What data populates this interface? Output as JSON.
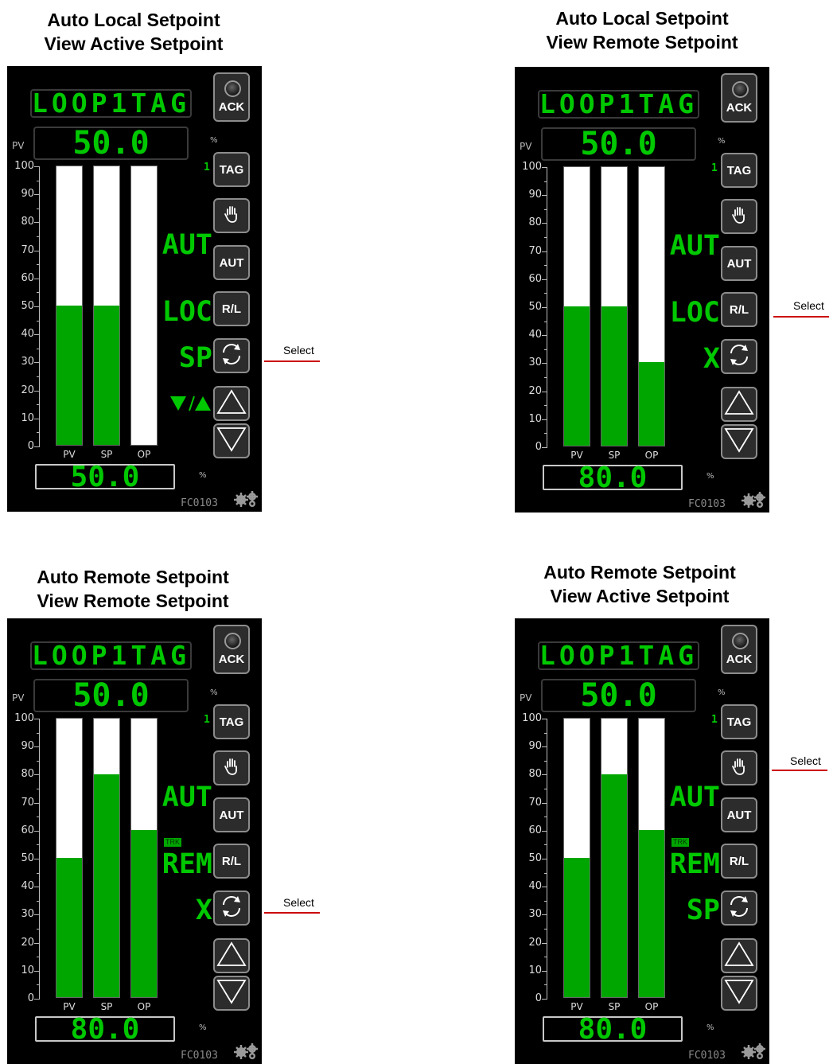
{
  "panels": [
    {
      "title1": "Auto Local Setpoint",
      "title2": "View Active Setpoint",
      "tag": "LOOP1TAG",
      "pv_label": "PV",
      "pv": "50.0",
      "unit": "%",
      "op": "50.0",
      "tag_code": "FC0103",
      "bars": {
        "PV": 50,
        "SP": 50,
        "OP": 0
      },
      "bar_labels": [
        "PV",
        "SP",
        "OP"
      ],
      "loop_num": "1",
      "mode": "AUT",
      "sp_mode": "LOC",
      "sp_view": "SP",
      "show_arrows": true,
      "trk": false,
      "buttons": {
        "ack": "ACK",
        "tag": "TAG",
        "aut": "AUT",
        "rl": "R/L"
      },
      "select_label": "Select",
      "select_target": "cycle"
    },
    {
      "title1": "Auto Local Setpoint",
      "title2": "View Remote Setpoint",
      "tag": "LOOP1TAG",
      "pv_label": "PV",
      "pv": "50.0",
      "unit": "%",
      "op": "80.0",
      "tag_code": "FC0103",
      "bars": {
        "PV": 50,
        "SP": 50,
        "OP": 30
      },
      "bar_labels": [
        "PV",
        "SP",
        "OP"
      ],
      "loop_num": "1",
      "mode": "AUT",
      "sp_mode": "LOC",
      "sp_view": "X",
      "show_arrows": false,
      "trk": false,
      "buttons": {
        "ack": "ACK",
        "tag": "TAG",
        "aut": "AUT",
        "rl": "R/L"
      },
      "select_label": "Select",
      "select_target": "rl"
    },
    {
      "title1": "Auto Remote Setpoint",
      "title2": "View Remote Setpoint",
      "tag": "LOOP1TAG",
      "pv_label": "PV",
      "pv": "50.0",
      "unit": "%",
      "op": "80.0",
      "tag_code": "FC0103",
      "bars": {
        "PV": 50,
        "SP": 80,
        "OP": 60
      },
      "bar_labels": [
        "PV",
        "SP",
        "OP"
      ],
      "loop_num": "1",
      "mode": "AUT",
      "sp_mode": "REM",
      "sp_view": "X",
      "show_arrows": false,
      "trk": true,
      "trk_label": "TRK",
      "buttons": {
        "ack": "ACK",
        "tag": "TAG",
        "aut": "AUT",
        "rl": "R/L"
      },
      "select_label": "Select",
      "select_target": "cycle"
    },
    {
      "title1": "Auto Remote Setpoint",
      "title2": "View Active Setpoint",
      "tag": "LOOP1TAG",
      "pv_label": "PV",
      "pv": "50.0",
      "unit": "%",
      "op": "80.0",
      "tag_code": "FC0103",
      "bars": {
        "PV": 50,
        "SP": 80,
        "OP": 60
      },
      "bar_labels": [
        "PV",
        "SP",
        "OP"
      ],
      "loop_num": "1",
      "mode": "AUT",
      "sp_mode": "REM",
      "sp_view": "SP",
      "show_arrows": false,
      "trk": true,
      "trk_label": "TRK",
      "buttons": {
        "ack": "ACK",
        "tag": "TAG",
        "aut": "AUT",
        "rl": "R/L"
      },
      "select_label": "Select",
      "select_target": "hand"
    }
  ],
  "scale_ticks": [
    "100",
    "90",
    "80",
    "70",
    "60",
    "50",
    "40",
    "30",
    "20",
    "10",
    "0"
  ],
  "colors": {
    "bar_fill": "#00a600",
    "text_green": "#00c800",
    "select_line": "#cc0000"
  }
}
